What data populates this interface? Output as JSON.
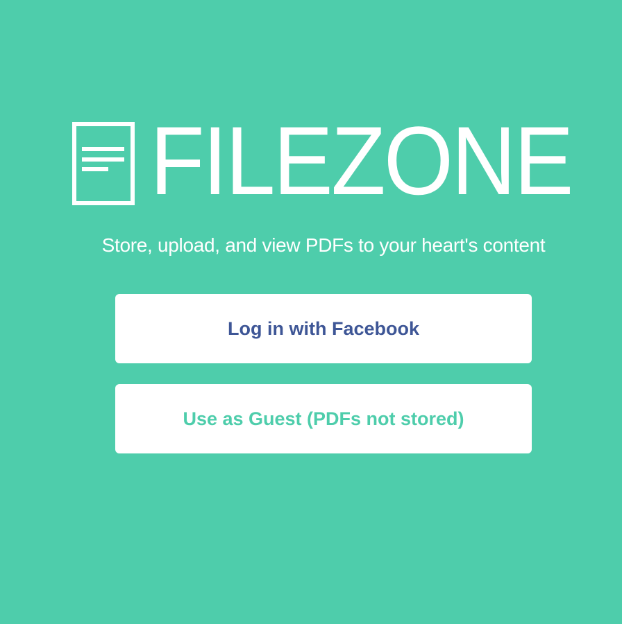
{
  "app": {
    "logo_text": "FILEZONE",
    "logo_icon": "document-icon",
    "tagline": "Store, upload, and view PDFs to your heart's content"
  },
  "actions": {
    "facebook_label": "Log in with Facebook",
    "guest_label": "Use as Guest (PDFs not stored)"
  },
  "colors": {
    "background": "#4ecdab",
    "facebook_text": "#3e5696",
    "guest_text": "#4ecdab",
    "button_bg": "#ffffff"
  }
}
